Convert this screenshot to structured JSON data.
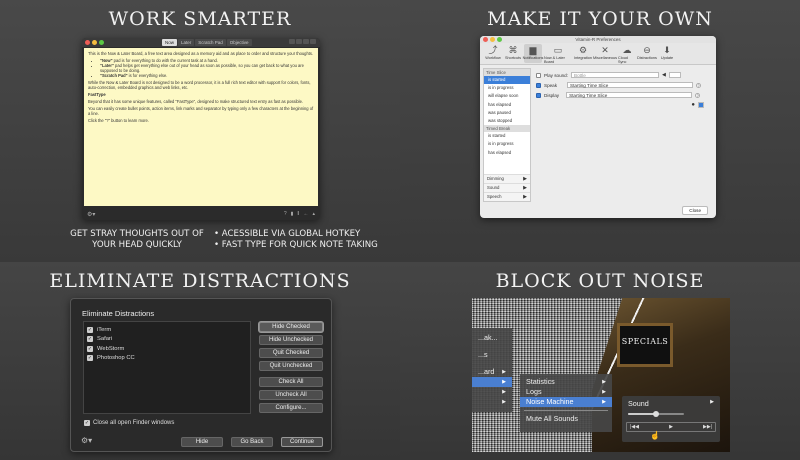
{
  "quadrants": {
    "work_smarter": {
      "title": "WORK SMARTER",
      "notes": {
        "tabs": [
          "Now",
          "Later",
          "Scratch Pad",
          "Objective"
        ],
        "active_tab": "Now",
        "intro": "This is the Now & Later Board, a free text area designed as a memory aid and as place to order and structure your thoughts.",
        "bullets": [
          {
            "bold": "\"Now\"",
            "rest": " pad is for everything to do with the current task at a hand."
          },
          {
            "bold": "\"Later\"",
            "rest": " pad helps get everything else out of your head as soon as possible, so you can get back to what you are supposed to be doing."
          },
          {
            "bold": "\"Scratch Pad\"",
            "rest": " is for everything else."
          }
        ],
        "para2": "While the Now & Later Board is not designed to be a word processor, it is a full rich text editor with support for colors, fonts, auto-correction, embedded graphics and web links, etc.",
        "heading": "FastType",
        "para3": "Beyond that it has some unique features, called \"FastType\", designed to make structured text entry as fast as possible.",
        "para4": "You can easily create bullet points, action items, link marks and separator by typing only a few characters at the beginning of a line.",
        "para5": "Click the \"?\" button to learn more."
      },
      "left_caption": "GET STRAY THOUGHTS OUT OF YOUR HEAD QUICKLY",
      "right_caption_1": "• ACESSIBLE VIA GLOBAL HOTKEY",
      "right_caption_2": "• FAST TYPE FOR QUICK NOTE TAKING"
    },
    "make_it_your_own": {
      "title": "MAKE IT YOUR OWN",
      "window_title": "Vitamin-R Preferences",
      "toolbar": [
        {
          "label": "Workflow",
          "icon": "workflow-icon"
        },
        {
          "label": "Shortcuts",
          "icon": "command-icon"
        },
        {
          "label": "Notifications",
          "icon": "speech-icon"
        },
        {
          "label": "Now & Later Board",
          "icon": "board-icon"
        },
        {
          "label": "Integration",
          "icon": "gear-icon"
        },
        {
          "label": "Miscellaneous",
          "icon": "tools-icon"
        },
        {
          "label": "Cloud Sync",
          "icon": "cloud-icon"
        },
        {
          "label": "Distractions",
          "icon": "no-entry-icon"
        },
        {
          "label": "Update",
          "icon": "download-icon"
        }
      ],
      "active_toolbar": "Notifications",
      "side_head_1": "Time Slice",
      "side_items_1": [
        "is started",
        "is in progress",
        "will elapse soon",
        "has elapsed",
        "was paused",
        "was stopped"
      ],
      "side_head_2": "Timed Break",
      "side_items_2": [
        "is started",
        "is in progress",
        "has elapsed"
      ],
      "side_bottom": [
        "Dimming",
        "Sound",
        "Speech"
      ],
      "play_sound_label": "Play sound:",
      "play_sound_value": "Bottle",
      "speak_label": "Speak",
      "speak_value": "Starting Time Slice",
      "display_label": "Display",
      "display_value": "Starting Time Slice",
      "close_label": "Close"
    },
    "eliminate": {
      "title": "ELIMINATE DISTRACTIONS",
      "dialog_title": "Eliminate Distractions",
      "apps": [
        "iTerm",
        "Safari",
        "WebStorm",
        "Photoshop CC"
      ],
      "buttons": [
        "Hide Checked",
        "Hide Unchecked",
        "Quit Checked",
        "Quit Unchecked",
        "Check All",
        "Uncheck All",
        "Configure..."
      ],
      "close_finder": "Close all open Finder windows",
      "footer_buttons": [
        "Hide",
        "Go Back",
        "Continue"
      ]
    },
    "block_noise": {
      "title": "BLOCK OUT NOISE",
      "left_menu": [
        "...ak...",
        "...s",
        "...ard",
        "",
        "",
        ""
      ],
      "menu_items": [
        "Statistics",
        "Logs",
        "Noise Machine",
        "Mute All Sounds"
      ],
      "sound_label": "Sound",
      "sign_text": "SPECIALS",
      "volume": 0.5
    }
  }
}
